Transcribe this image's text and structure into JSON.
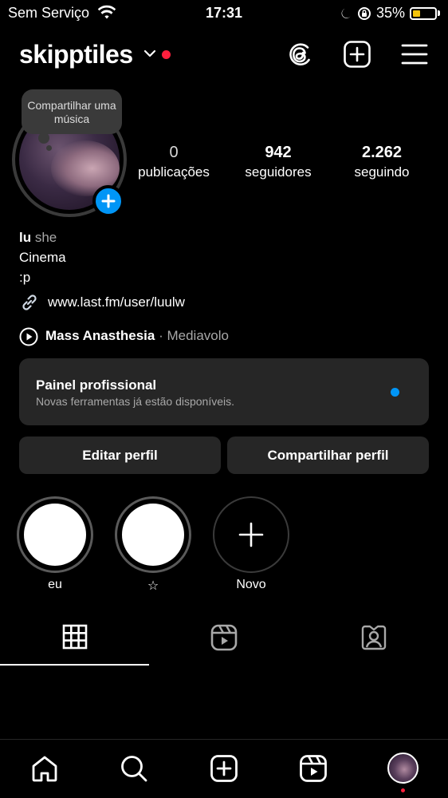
{
  "status_bar": {
    "carrier": "Sem Serviço",
    "time": "17:31",
    "battery": "35%",
    "battery_level": 0.35,
    "battery_color": "#f3c40b"
  },
  "header": {
    "username": "skipptiles",
    "icons": [
      "chevron-down-icon",
      "threads-icon",
      "create-post-icon",
      "menu-icon"
    ],
    "notification_color": "#ff1f3d"
  },
  "profile": {
    "note_bubble": "Compartilhar uma música",
    "stats": [
      {
        "value": "0",
        "label": "publicações"
      },
      {
        "value": "942",
        "label": "seguidores"
      },
      {
        "value": "2.262",
        "label": "seguindo"
      }
    ],
    "name": "lu",
    "pronouns": "she",
    "bio_lines": [
      "Cinema",
      ":p"
    ],
    "link": "www.last.fm/user/luulw",
    "music": {
      "song": "Mass Anasthesia",
      "separator": "·",
      "artist": "Mediavolo"
    }
  },
  "professional_panel": {
    "title": "Painel profissional",
    "subtitle": "Novas ferramentas já estão disponíveis.",
    "dot_color": "#0095f6"
  },
  "buttons": {
    "edit": "Editar perfil",
    "share": "Compartilhar perfil"
  },
  "highlights": [
    {
      "label": "eu"
    },
    {
      "label": "☆"
    },
    {
      "label": "Novo"
    }
  ],
  "tabs": [
    "grid-icon",
    "reels-icon",
    "tagged-icon"
  ],
  "bottom_nav": [
    "home-icon",
    "search-icon",
    "create-icon",
    "reels-icon",
    "profile-avatar"
  ],
  "accent": "#0095f6"
}
